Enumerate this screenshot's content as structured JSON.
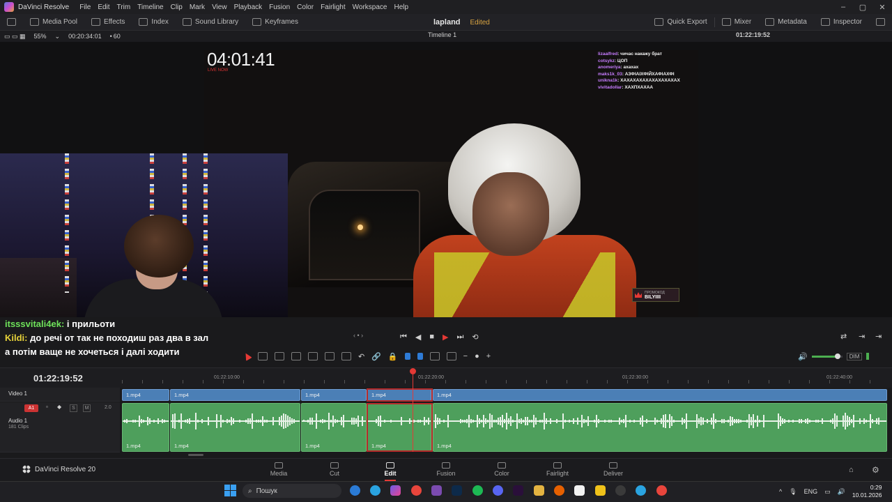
{
  "app": {
    "title": "DaVinci Resolve",
    "menu": [
      "File",
      "Edit",
      "Trim",
      "Timeline",
      "Clip",
      "Mark",
      "View",
      "Playback",
      "Fusion",
      "Color",
      "Fairlight",
      "Workspace",
      "Help"
    ],
    "window_controls": [
      "–",
      "▢",
      "✕"
    ]
  },
  "toolbar": {
    "left": [
      {
        "label": "Media Pool",
        "icon": "media-pool-icon"
      },
      {
        "label": "Effects",
        "icon": "effects-icon"
      },
      {
        "label": "Index",
        "icon": "index-icon"
      },
      {
        "label": "Sound Library",
        "icon": "sound-library-icon"
      },
      {
        "label": "Keyframes",
        "icon": "keyframes-icon"
      }
    ],
    "project_name": "lapland",
    "project_status": "Edited",
    "right": [
      {
        "label": "Quick Export",
        "icon": "quick-export-icon"
      },
      {
        "label": "Mixer",
        "icon": "mixer-icon"
      },
      {
        "label": "Metadata",
        "icon": "metadata-icon"
      },
      {
        "label": "Inspector",
        "icon": "inspector-icon"
      }
    ]
  },
  "viewer_bar": {
    "zoom": "55%",
    "source_timecode": "00:20:34:01",
    "fps": "60",
    "timeline_name": "Timeline 1",
    "record_timecode": "01:22:19:52"
  },
  "stream": {
    "timer": "04:01:41",
    "timer_sub": "LIVE NOW",
    "chat": [
      {
        "user": "lizaalfred",
        "text": "чичас накажу брат"
      },
      {
        "user": "cotsykz",
        "text": "ЦОП"
      },
      {
        "user": "anomeriya",
        "text": "ахахах"
      },
      {
        "user": "maks1k_03",
        "text": "АЗФІАІХФІЙХАФІАХФІ"
      },
      {
        "user": "unikna1k",
        "text": "ХАХАХАХАХАХАХАХАХАХ"
      },
      {
        "user": "vivitadollar",
        "text": "ХАХПХАХАА"
      }
    ],
    "promo_label": "ПРОМОКОД",
    "promo_code": "BILYIIII"
  },
  "chat_overlay": [
    {
      "nick": "itsssvitali4ek:",
      "text": "і прильоти",
      "color": "#6ee25a"
    },
    {
      "nick": "Kildi:",
      "text": "до речі от так не походиш раз два в зал",
      "color": "#e6d23a"
    },
    {
      "nick": "",
      "text": "а потім ваще не хочеться і далі ходити",
      "color": "#ffffff"
    }
  ],
  "timeline": {
    "current_timecode": "01:22:19:52",
    "ruler_labels": [
      "01:22:10:00",
      "01:22:20:00",
      "01:22:30:00",
      "01:22:40:00"
    ],
    "video_track": {
      "name": "Video 1"
    },
    "audio_track": {
      "name": "Audio 1",
      "clips_count": "181 Clips",
      "badge": "A1",
      "level": "2.0",
      "buttons": [
        "S",
        "M"
      ]
    },
    "clips": [
      "1.mp4",
      "1.mp4",
      "1.mp4",
      "1.mp4",
      "1.mp4"
    ],
    "volume_fraction": 0.85,
    "dim_label": "DIM"
  },
  "pages": {
    "brand": "DaVinci Resolve 20",
    "tabs": [
      "Media",
      "Cut",
      "Edit",
      "Fusion",
      "Color",
      "Fairlight",
      "Deliver"
    ],
    "active": "Edit"
  },
  "taskbar": {
    "search_placeholder": "Пошук",
    "language": "ENG",
    "time": "0:29",
    "date": "10.01.2026"
  }
}
